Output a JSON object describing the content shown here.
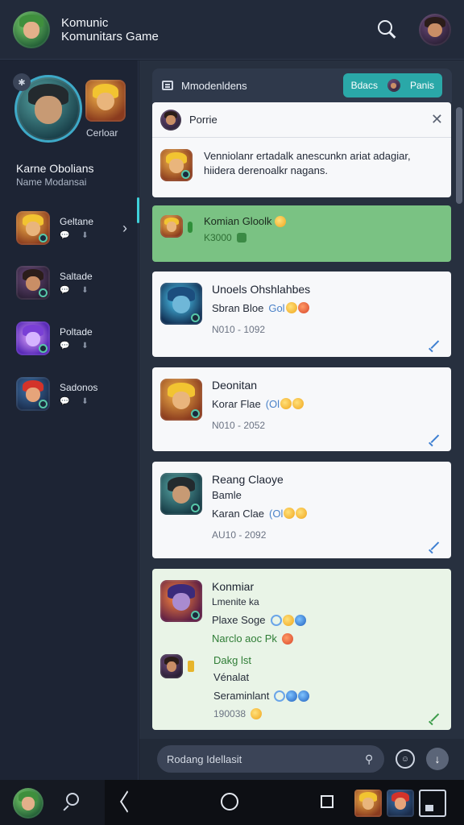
{
  "app": {
    "title_line1": "Komunic",
    "title_line2": "Komunitars Game"
  },
  "sidebar": {
    "profile_name": "Karne Obolians",
    "profile_sub": "Name Modansai",
    "side_label": "Cerloar",
    "contacts": [
      {
        "name": "Geltane",
        "icons": "💬 ⬇"
      },
      {
        "name": "Saltade",
        "icons": "💬 ⬇"
      },
      {
        "name": "Poltade",
        "icons": "💬 ⬇"
      },
      {
        "name": "Sadonos",
        "icons": "💬 ⬇"
      }
    ]
  },
  "chat": {
    "header_title": "Mmodenldens",
    "tab_1": "Bdacs",
    "tab_2": "Panis",
    "quoted": {
      "name": "Porrie",
      "text_line1": "Venniolanr ertadalk anescunkn ariat adagiar,",
      "text_line2": "hiidera derenoalkr nagans."
    },
    "green_msg": {
      "name": "Komian Gloolk",
      "sub": "K3000"
    },
    "messages": [
      {
        "title": "Unoels Ohshlahbes",
        "line": "Sbran Bloe",
        "tag": "Gol",
        "time": "N010 - 1092"
      },
      {
        "title": "Deonitan",
        "line": "Korar Flae",
        "tag": "(Ol",
        "time": "N010 - 2052"
      },
      {
        "title": "Reang Claoye",
        "line2": "Bamle",
        "line": "Karan Clae",
        "tag": "(Ol",
        "time": "AU10 - 2092"
      }
    ],
    "last_msg": {
      "title": "Konmiar",
      "sub": "Lmenite ka",
      "line": "Plaxe Soge",
      "green_line": "Narclo aoc Pk",
      "reply_name": "Dakg lst",
      "reply_sub": "Vénalat",
      "reply_line": "Seraminlant",
      "time": "190038"
    },
    "composer_placeholder": "Rodang Idellasit"
  },
  "colors": {
    "accent_teal": "#2aa8a8",
    "green_bubble": "#7ac283",
    "mint_bubble": "#e9f4e7",
    "sidebar_bg": "#1d2434"
  },
  "icons": [
    "search-icon",
    "close-icon",
    "double-check-icon",
    "send-icon",
    "emoji-icon",
    "pin-icon",
    "chevron-right-icon",
    "back-nav-icon",
    "home-nav-icon",
    "recents-nav-icon"
  ]
}
